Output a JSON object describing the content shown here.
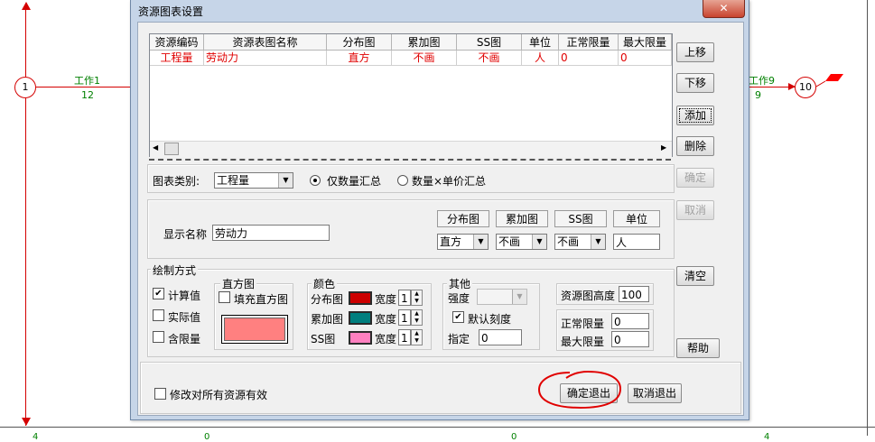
{
  "diagram": {
    "nodes": [
      {
        "label": "1"
      },
      {
        "label": "10"
      }
    ],
    "works": [
      {
        "name": "工作1",
        "duration": "12"
      },
      {
        "name": "工作9",
        "duration": "9"
      }
    ],
    "bottom_numbers": [
      "4",
      "0",
      "0",
      "4"
    ],
    "colors": {
      "line": "#d40000",
      "text": "#008000"
    }
  },
  "dialog": {
    "title": "资源图表设置",
    "close_label": "✕"
  },
  "table": {
    "columns": [
      "资源编码",
      "资源表图名称",
      "分布图",
      "累加图",
      "SS图",
      "单位",
      "正常限量",
      "最大限量"
    ],
    "rows": [
      [
        "工程量",
        "劳动力",
        "直方",
        "不画",
        "不画",
        "人",
        "0",
        "0"
      ]
    ]
  },
  "side_buttons": {
    "up": "上移",
    "down": "下移",
    "add": "添加",
    "delete": "删除",
    "confirm": "确定",
    "cancel": "取消",
    "clear": "清空",
    "help": "帮助"
  },
  "chart_type": {
    "label": "图表类别:",
    "value": "工程量",
    "radio_qty": "仅数量汇总",
    "radio_price": "数量×单价汇总"
  },
  "display": {
    "name_label": "显示名称",
    "name_value": "劳动力",
    "headers": [
      "分布图",
      "累加图",
      "SS图",
      "单位"
    ],
    "values": [
      "直方",
      "不画",
      "不画",
      "人"
    ]
  },
  "draw": {
    "group_label": "绘制方式",
    "calc": "计算值",
    "actual": "实际值",
    "limit": "含限量",
    "hist_label": "直方图",
    "fill_hist": "填充直方图",
    "hist_color": "#ff8080"
  },
  "color_group": {
    "label": "颜色",
    "rows": [
      {
        "label": "分布图",
        "color": "#cc0000",
        "width_label": "宽度",
        "width": "1"
      },
      {
        "label": "累加图",
        "color": "#007f7f",
        "width_label": "宽度",
        "width": "1"
      },
      {
        "label": "SS图",
        "color": "#ff80c0",
        "width_label": "宽度",
        "width": "1"
      }
    ]
  },
  "other_group": {
    "label": "其他",
    "strength_label": "强度",
    "default_scale": "默认刻度",
    "specify_label": "指定",
    "specify_value": "0"
  },
  "resource_height": {
    "label": "资源图高度",
    "value": "100"
  },
  "limits": {
    "normal_label": "正常限量",
    "normal_value": "0",
    "max_label": "最大限量",
    "max_value": "0"
  },
  "footer": {
    "apply_all": "修改对所有资源有效",
    "ok_exit": "确定退出",
    "cancel_exit": "取消退出",
    "highlight_color": "#e00000"
  }
}
